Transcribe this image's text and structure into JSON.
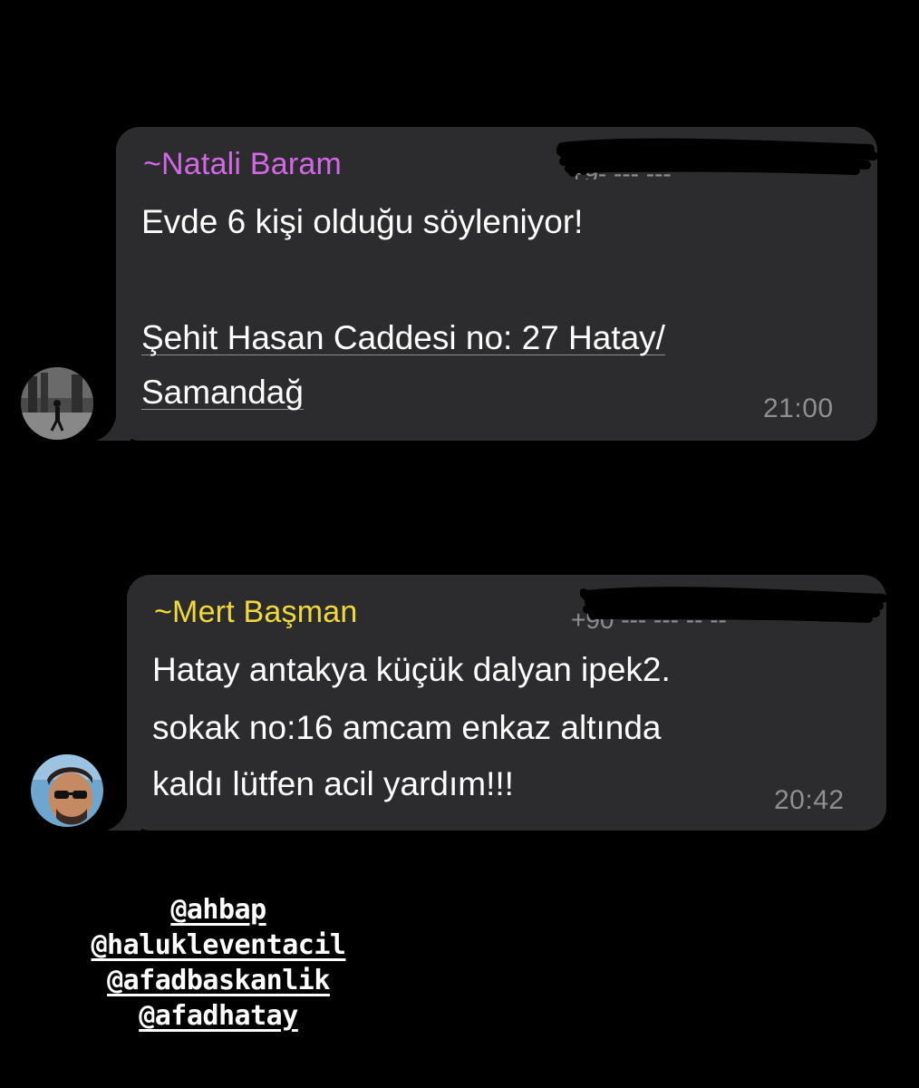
{
  "messages": [
    {
      "sender": "~Natali Baram",
      "sender_color": "#d268e6",
      "phone_visible": "+9- --- ---",
      "text_line_1": "Evde 6 kişi olduğu söyleniyor!",
      "text_line_2": "Şehit Hasan Caddesi no: 27 Hatay/",
      "text_line_3": "Samandağ",
      "time": "21:00",
      "avatar_icon": "person-silhouette-avatar"
    },
    {
      "sender": "~Mert Başman",
      "sender_color": "#f2d93a",
      "phone_visible": "+90 --- --- -- --",
      "text_line_1": "Hatay antakya küçük dalyan ipek2.",
      "text_line_2": "sokak no:16 amcam enkaz altında",
      "text_line_3": "kaldı lütfen acil yardım!!!",
      "time": "20:42",
      "avatar_icon": "man-with-sunglasses-avatar"
    }
  ],
  "mentions": [
    "@ahbap",
    "@halukleventacil",
    "@afadbaskanlik",
    "@afadhatay"
  ],
  "colors": {
    "background": "#000000",
    "bubble": "#2c2c2e",
    "text": "#ffffff",
    "timestamp": "#8e8e93"
  }
}
